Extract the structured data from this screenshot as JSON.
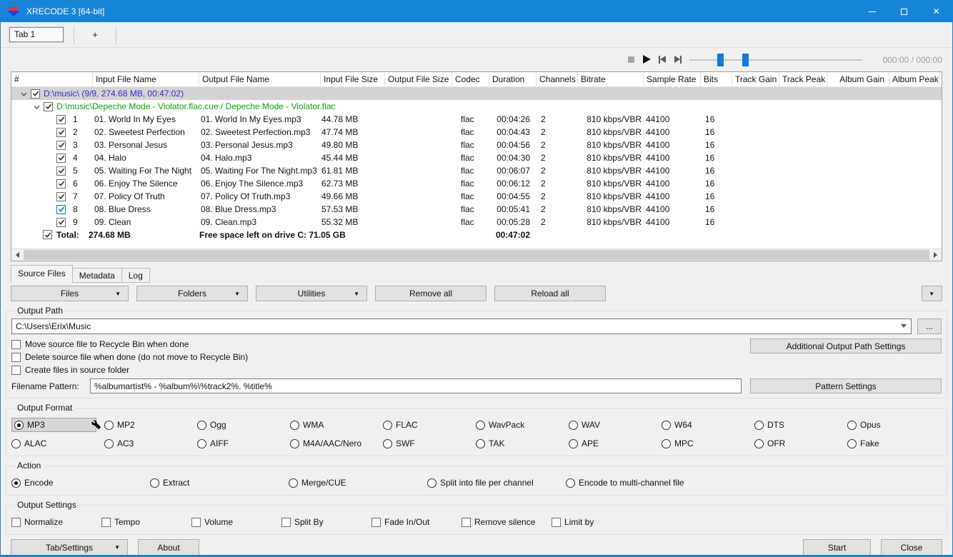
{
  "window": {
    "title": "XRECODE 3 [64-bit]"
  },
  "tab_strip": {
    "tab1": "Tab 1",
    "new_tab": "+"
  },
  "player": {
    "time_display": "000:00 / 000:00"
  },
  "table": {
    "columns": [
      "#",
      "Input File Name",
      "Output File Name",
      "Input File Size",
      "Output File Size",
      "Codec",
      "Duration",
      "Channels",
      "Bitrate",
      "Sample Rate",
      "Bits",
      "Track Gain",
      "Track Peak",
      "Album Gain",
      "Album Peak"
    ],
    "group_row": "D:\\music\\ (9/9, 274.68 MB, 00:47:02)",
    "album_row": "D:\\music\\Depeche Mode - Violator.flac.cue / Depeche Mode - Violator.flac",
    "rows": [
      {
        "num": "1",
        "input": "01. World In My Eyes",
        "output": "01. World In My Eyes.mp3",
        "size": "44.78 MB",
        "codec": "flac",
        "duration": "00:04:26",
        "channels": "2",
        "bitrate": "810 kbps/VBR",
        "sample_rate": "44100",
        "bits": "16"
      },
      {
        "num": "2",
        "input": "02. Sweetest Perfection",
        "output": "02. Sweetest Perfection.mp3",
        "size": "47.74 MB",
        "codec": "flac",
        "duration": "00:04:43",
        "channels": "2",
        "bitrate": "810 kbps/VBR",
        "sample_rate": "44100",
        "bits": "16"
      },
      {
        "num": "3",
        "input": "03. Personal Jesus",
        "output": "03. Personal Jesus.mp3",
        "size": "49.80 MB",
        "codec": "flac",
        "duration": "00:04:56",
        "channels": "2",
        "bitrate": "810 kbps/VBR",
        "sample_rate": "44100",
        "bits": "16"
      },
      {
        "num": "4",
        "input": "04. Halo",
        "output": "04. Halo.mp3",
        "size": "45.44 MB",
        "codec": "flac",
        "duration": "00:04:30",
        "channels": "2",
        "bitrate": "810 kbps/VBR",
        "sample_rate": "44100",
        "bits": "16"
      },
      {
        "num": "5",
        "input": "05. Waiting For The Night",
        "output": "05. Waiting For The Night.mp3",
        "size": "61.81 MB",
        "codec": "flac",
        "duration": "00:06:07",
        "channels": "2",
        "bitrate": "810 kbps/VBR",
        "sample_rate": "44100",
        "bits": "16"
      },
      {
        "num": "6",
        "input": "06. Enjoy The Silence",
        "output": "06. Enjoy The Silence.mp3",
        "size": "62.73 MB",
        "codec": "flac",
        "duration": "00:06:12",
        "channels": "2",
        "bitrate": "810 kbps/VBR",
        "sample_rate": "44100",
        "bits": "16"
      },
      {
        "num": "7",
        "input": "07. Policy Of Truth",
        "output": "07. Policy Of Truth.mp3",
        "size": "49.66 MB",
        "codec": "flac",
        "duration": "00:04:55",
        "channels": "2",
        "bitrate": "810 kbps/VBR",
        "sample_rate": "44100",
        "bits": "16"
      },
      {
        "num": "8",
        "input": "08. Blue Dress",
        "output": "08. Blue Dress.mp3",
        "size": "57.53 MB",
        "codec": "flac",
        "duration": "00:05:41",
        "channels": "2",
        "bitrate": "810 kbps/VBR",
        "sample_rate": "44100",
        "bits": "16"
      },
      {
        "num": "9",
        "input": "09. Clean",
        "output": "09. Clean.mp3",
        "size": "55.32 MB",
        "codec": "flac",
        "duration": "00:05:28",
        "channels": "2",
        "bitrate": "810 kbps/VBR",
        "sample_rate": "44100",
        "bits": "16"
      }
    ],
    "total_row": {
      "label": "Total:",
      "size": "274.68 MB",
      "free_space": "Free space left on drive C: 71.05 GB",
      "duration": "00:47:02"
    }
  },
  "panel_tabs": [
    "Source Files",
    "Metadata",
    "Log"
  ],
  "active_panel_tab": "Source Files",
  "toolbar": {
    "files": "Files",
    "folders": "Folders",
    "utilities": "Utilities",
    "remove_all": "Remove all",
    "reload_all": "Reload all"
  },
  "output_path": {
    "legend": "Output Path",
    "path_value": "C:\\Users\\Erix\\Music",
    "browse_label": "...",
    "additional_button": "Additional Output Path Settings",
    "options": [
      "Move source file to Recycle Bin when done",
      "Delete source file when done (do not move to Recycle Bin)",
      "Create files in source folder"
    ],
    "pattern_label": "Filename Pattern:",
    "pattern_value": "%albumartist% - %album%\\%track2%. %title%",
    "pattern_button": "Pattern Settings"
  },
  "output_format": {
    "legend": "Output Format",
    "selected": "MP3",
    "row1": [
      "MP3",
      "MP2",
      "Ogg",
      "WMA",
      "FLAC",
      "WavPack",
      "WAV",
      "W64",
      "DTS",
      "Opus"
    ],
    "row2": [
      "ALAC",
      "AC3",
      "AIFF",
      "M4A/AAC/Nero",
      "SWF",
      "TAK",
      "APE",
      "MPC",
      "OFR",
      "Fake"
    ]
  },
  "action": {
    "legend": "Action",
    "selected": "Encode",
    "options": [
      "Encode",
      "Extract",
      "Merge/CUE",
      "Split into file per channel",
      "Encode to multi-channel file"
    ]
  },
  "output_settings": {
    "legend": "Output Settings",
    "options": [
      "Normalize",
      "Tempo",
      "Volume",
      "Split By",
      "Fade In/Out",
      "Remove silence",
      "Limit by"
    ]
  },
  "footer": {
    "tab_settings": "Tab/Settings",
    "about": "About",
    "start": "Start",
    "close": "Close"
  },
  "colors": {
    "titlebar": "#1784d8",
    "accent": "#0f7ad8",
    "path_blue": "#2b2bcf",
    "path_green": "#10a010",
    "group_row_bg": "#d4d4d4"
  }
}
